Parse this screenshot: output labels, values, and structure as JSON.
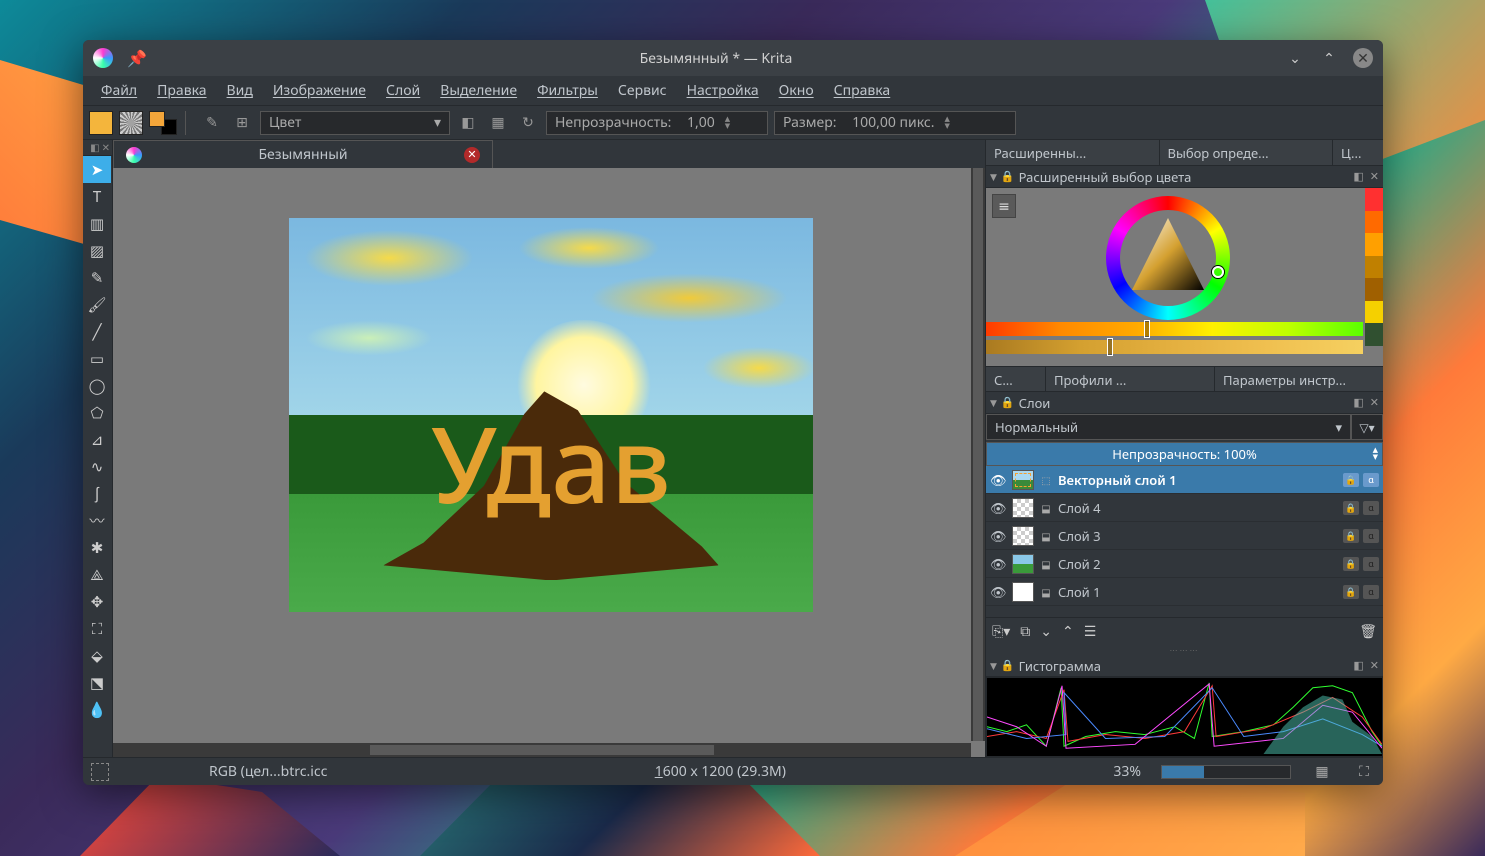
{
  "window": {
    "title": "Безымянный * — Krita"
  },
  "menu": [
    "Файл",
    "Правка",
    "Вид",
    "Изображение",
    "Слой",
    "Выделение",
    "Фильтры",
    "Сервис",
    "Настройка",
    "Окно",
    "Справка"
  ],
  "toolbar": {
    "blendmode": "Цвет",
    "opacity_label": "Непрозрачность:",
    "opacity_value": "1,00",
    "size_label": "Размер:",
    "size_value": "100,00 пикс."
  },
  "doc_tab": {
    "title": "Безымянный"
  },
  "canvas_text": "Удав",
  "right_tabs_top": [
    "Расширенны...",
    "Выбор опреде...",
    "Ц..."
  ],
  "color_panel_title": "Расширенный выбор цвета",
  "swatch_colors": [
    "#ff3030",
    "#ff6a00",
    "#ffa000",
    "#c08000",
    "#a06000",
    "#f5d000",
    "#305030"
  ],
  "right_tabs_mid": [
    "С...",
    "Профили ...",
    "Параметры инстр..."
  ],
  "layers_panel": {
    "title": "Слои",
    "blend_mode": "Нормальный",
    "opacity_label": "Непрозрачность:  100%",
    "layers": [
      {
        "name": "Векторный слой 1",
        "selected": true,
        "thumb": "vector"
      },
      {
        "name": "Слой 4",
        "selected": false,
        "thumb": "checker"
      },
      {
        "name": "Слой 3",
        "selected": false,
        "thumb": "checker"
      },
      {
        "name": "Слой 2",
        "selected": false,
        "thumb": "painting"
      },
      {
        "name": "Слой 1",
        "selected": false,
        "thumb": "white"
      }
    ]
  },
  "histogram_title": "Гистограмма",
  "statusbar": {
    "colorspace": "RGB (цел...btrc.icc",
    "dimensions": "1600 x 1200 (29.3M)",
    "zoom": "33%"
  },
  "tools": [
    "cursor",
    "text",
    "edit",
    "calligraphy",
    "pencil",
    "brush",
    "line",
    "rect",
    "ellipse",
    "polygon",
    "polyline",
    "bezier",
    "freehand",
    "dynamic",
    "multi",
    "crop",
    "move",
    "transform",
    "gradient",
    "pattern",
    "eyedropper"
  ]
}
